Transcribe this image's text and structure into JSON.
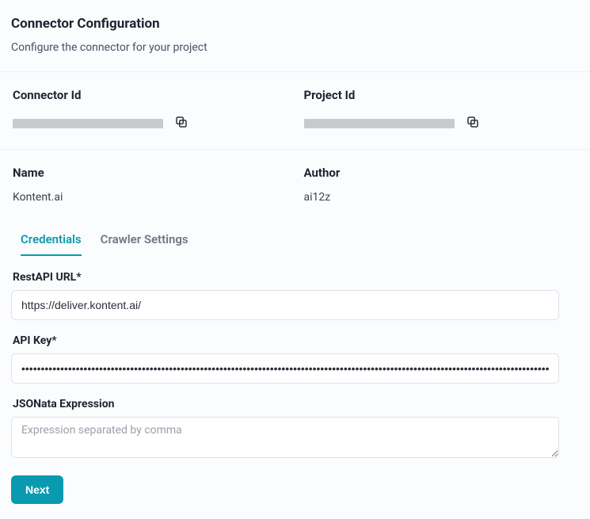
{
  "header": {
    "title": "Connector Configuration",
    "subtitle": "Configure the connector for your project"
  },
  "info": {
    "connector_id_label": "Connector Id",
    "connector_id_value": "",
    "project_id_label": "Project Id",
    "project_id_value": "",
    "name_label": "Name",
    "name_value": "Kontent.ai",
    "author_label": "Author",
    "author_value": "ai12z"
  },
  "tabs": {
    "credentials": "Credentials",
    "crawler": "Crawler Settings",
    "active": "credentials"
  },
  "form": {
    "restapi_label": "RestAPI URL*",
    "restapi_value": "https://deliver.kontent.ai/",
    "apikey_label": "API Key*",
    "apikey_value": "••••••••••••••••••••••••••••••••••••••••••••••••••••••••••••••••••••••••••••••••••••••••••••••••••••••••••••••••••••••••••••••••••••••••",
    "jsonata_label": "JSONata Expression",
    "jsonata_value": "",
    "jsonata_placeholder": "Expression separated by comma"
  },
  "buttons": {
    "next": "Next"
  },
  "icons": {
    "copy": "copy-icon"
  }
}
